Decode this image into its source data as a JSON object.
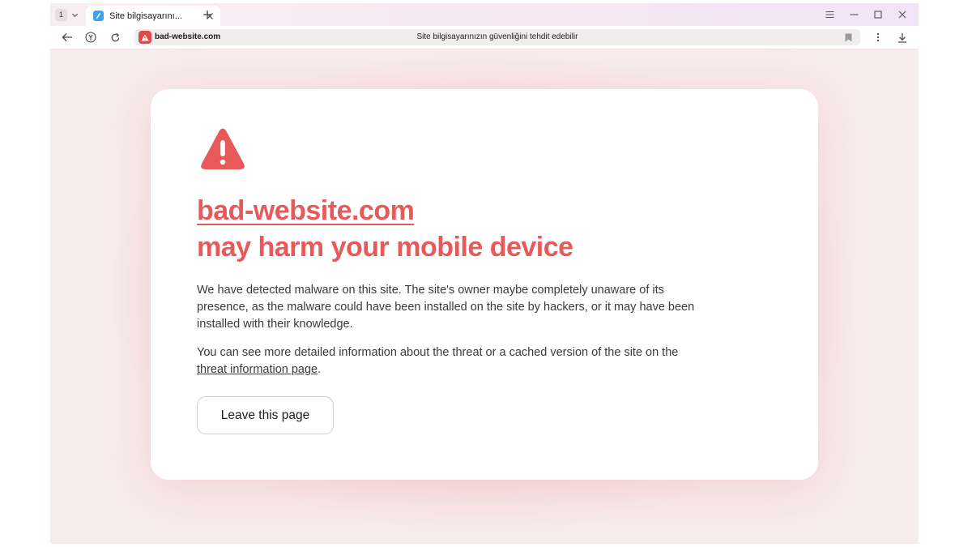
{
  "colors": {
    "accent": "#e85a5a",
    "warning_red": "#e24848",
    "favicon_blue": "#3aa3f4",
    "page_background": "#f7ecec"
  },
  "tabstrip": {
    "tab_count": "1",
    "active_tab_title": "Site bilgisayarını...",
    "icons": [
      "chevron-down-icon",
      "close-icon",
      "plus-icon",
      "menu-icon",
      "minimize-icon",
      "maximize-icon",
      "close-icon"
    ]
  },
  "toolbar": {
    "icons": [
      "back-arrow-icon",
      "yandex-logo-icon",
      "reload-icon",
      "bookmark-icon",
      "more-vertical-icon",
      "download-icon"
    ]
  },
  "omnibox": {
    "domain": "bad-website.com",
    "status_text": "Site bilgisayarınızın güvenliğini tehdit edebilir"
  },
  "warning": {
    "icon": "alert-triangle-icon",
    "site_link": "bad-website.com",
    "headline": "may harm your mobile device",
    "paragraph1": "We have detected malware on this site. The site's owner maybe completely unaware of its presence, as the malware could have been installed on the site by hackers, or it may have been installed with their knowledge.",
    "paragraph2_before": "You can see more detailed information about the threat or a cached version of the site on the ",
    "paragraph2_link": "threat information page",
    "paragraph2_after": ".",
    "leave_button": "Leave this page"
  }
}
